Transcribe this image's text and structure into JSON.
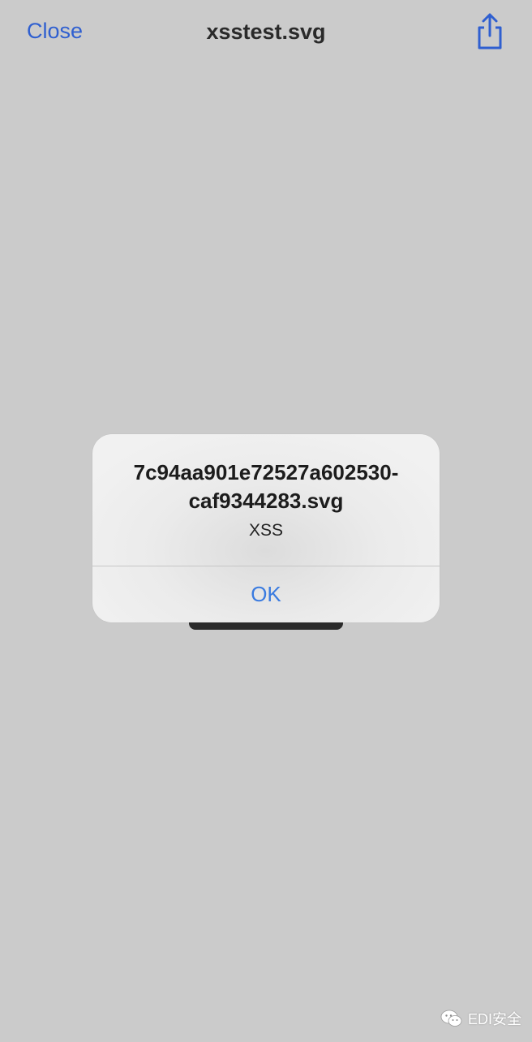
{
  "nav": {
    "close_label": "Close",
    "title": "xsstest.svg",
    "share_icon": "share-icon"
  },
  "alert": {
    "title": "7c94aa901e72527a602530-caf9344283.svg",
    "message": "XSS",
    "ok_label": "OK"
  },
  "watermark": {
    "text": "EDI安全",
    "icon": "wechat-icon"
  },
  "colors": {
    "background": "#cbcbcb",
    "accent": "#2f5fd0",
    "alert_button": "#3a7be0"
  }
}
